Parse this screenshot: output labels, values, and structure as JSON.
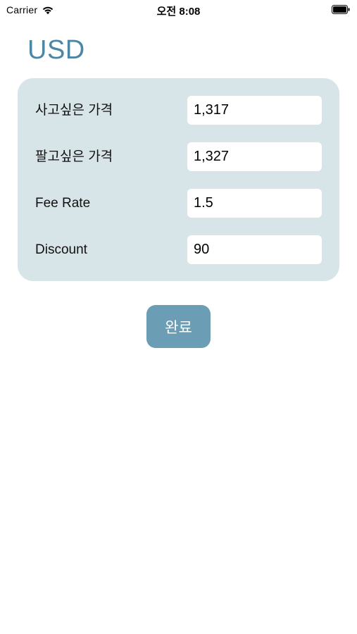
{
  "status_bar": {
    "carrier": "Carrier",
    "time": "오전 8:08",
    "wifi_icon": "wifi-icon",
    "battery_icon": "battery-icon"
  },
  "header": {
    "title": "USD"
  },
  "form": {
    "rows": [
      {
        "label": "사고싶은 가격",
        "value": "1,317"
      },
      {
        "label": "팔고싶은 가격",
        "value": "1,327"
      },
      {
        "label": "Fee Rate",
        "value": "1.5"
      },
      {
        "label": "Discount",
        "value": "90"
      }
    ]
  },
  "actions": {
    "done_label": "완료"
  },
  "colors": {
    "accent": "#4a87a6",
    "card_background": "#d7e4e8",
    "button_background": "#6b9db4"
  }
}
